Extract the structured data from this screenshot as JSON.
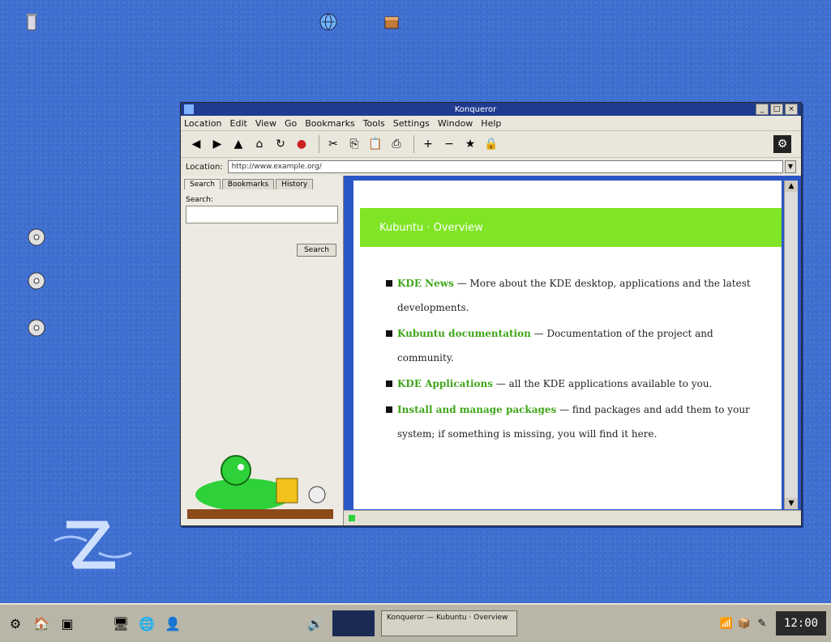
{
  "desktop": {
    "icons": [
      {
        "name": "trash-icon",
        "glyph": "🗑"
      },
      {
        "name": "globe-icon",
        "glyph": "🌐"
      },
      {
        "name": "package-icon",
        "glyph": "📦"
      },
      {
        "name": "cd-icon",
        "glyph": "💿"
      },
      {
        "name": "cd-icon-2",
        "glyph": "💿"
      },
      {
        "name": "cd-icon-3",
        "glyph": "💿"
      }
    ]
  },
  "window": {
    "title": "Konqueror",
    "controls": {
      "minimize": "_",
      "maximize": "□",
      "close": "×"
    },
    "menu": [
      "Location",
      "Edit",
      "View",
      "Go",
      "Bookmarks",
      "Tools",
      "Settings",
      "Window",
      "Help"
    ],
    "location_label": "Location:",
    "location_value": "http://www.example.org/",
    "sidebar": {
      "tabs": [
        "Search",
        "Bookmarks",
        "History"
      ],
      "search_label": "Search:",
      "search_button": "Search"
    },
    "page": {
      "banner_title": "Kubuntu · Overview",
      "items": [
        {
          "link": "KDE News",
          "text": " — More about the KDE desktop, applications and the latest developments."
        },
        {
          "link": "Kubuntu documentation",
          "text": " — Documentation of the project and community."
        },
        {
          "link": "KDE Applications",
          "text": " — all the KDE applications available to you."
        },
        {
          "link": "Install and manage packages",
          "text": " — find packages and add them to your system; if something is missing, you will find it here."
        }
      ]
    },
    "status_text": ""
  },
  "taskbar": {
    "task_label": "Konqueror — Kubuntu · Overview",
    "clock": "12:00"
  },
  "colors": {
    "desktop": "#3f6fd0",
    "banner": "#7fe524",
    "link": "#3fa51a",
    "titlebar": "#1e3b8f"
  }
}
